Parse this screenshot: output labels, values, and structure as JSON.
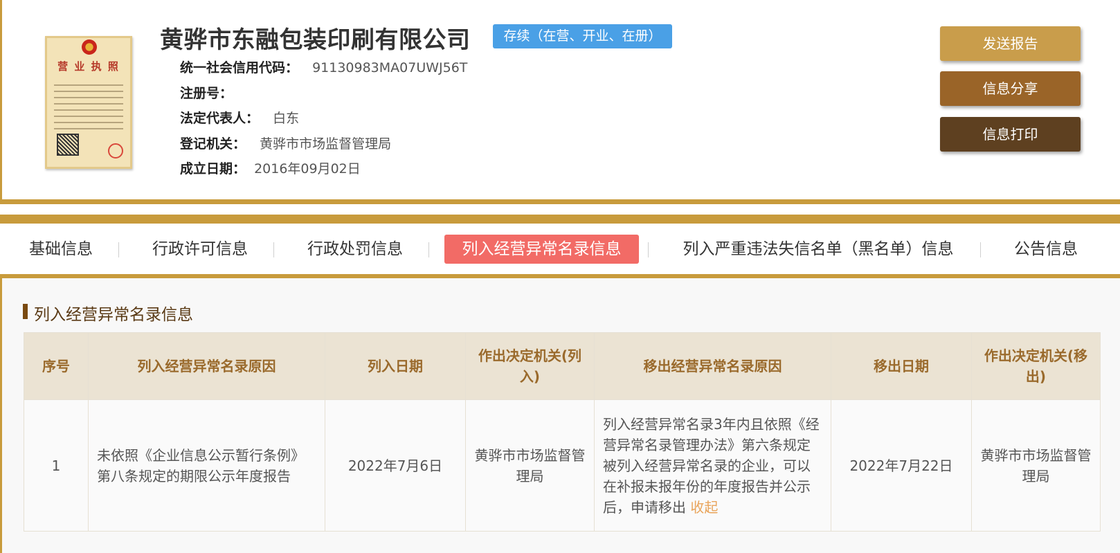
{
  "company": {
    "name": "黄骅市东融包装印刷有限公司",
    "status": "存续（在营、开业、在册）",
    "license_image": {
      "title": "营 业 执 照"
    }
  },
  "info": [
    {
      "label": "统一社会信用代码：",
      "value": "91130983MA07UWJ56T"
    },
    {
      "label": "注册号：",
      "value": ""
    },
    {
      "label": "法定代表人：",
      "value": "白东"
    },
    {
      "label": "登记机关：",
      "value": "黄骅市市场监督管理局"
    },
    {
      "label": "成立日期：",
      "value": "2016年09月02日"
    }
  ],
  "actions": {
    "send": "发送报告",
    "share": "信息分享",
    "print": "信息打印"
  },
  "tabs": [
    {
      "label": "基础信息",
      "active": false
    },
    {
      "label": "行政许可信息",
      "active": false
    },
    {
      "label": "行政处罚信息",
      "active": false
    },
    {
      "label": "列入经营异常名录信息",
      "active": true
    },
    {
      "label": "列入严重违法失信名单（黑名单）信息",
      "active": false
    },
    {
      "label": "公告信息",
      "active": false
    }
  ],
  "section": {
    "title": "列入经营异常名录信息"
  },
  "table": {
    "headers": [
      "序号",
      "列入经营异常名录原因",
      "列入日期",
      "作出决定机关(列入)",
      "移出经营异常名录原因",
      "移出日期",
      "作出决定机关(移出)"
    ],
    "rows": [
      {
        "index": "1",
        "reason_in": "未依照《企业信息公示暂行条例》第八条规定的期限公示年度报告",
        "date_in": "2022年7月6日",
        "authority_in": "黄骅市市场监督管理局",
        "reason_out": "列入经营异常名录3年内且依照《经营异常名录管理办法》第六条规定被列入经营异常名录的企业，可以在补报未报年份的年度报告并公示后，申请移出",
        "reason_out_toggle": "收起",
        "date_out": "2022年7月22日",
        "authority_out": "黄骅市市场监督管理局"
      }
    ]
  },
  "colors": {
    "gold": "#c89b3c",
    "status_blue": "#4aa0e6",
    "active_tab": "#f26b66",
    "btn_send": "#c99d4b",
    "btn_share": "#9a6428",
    "btn_print": "#5e4020",
    "header_text": "#9a6a2c",
    "link": "#e9a45a"
  }
}
